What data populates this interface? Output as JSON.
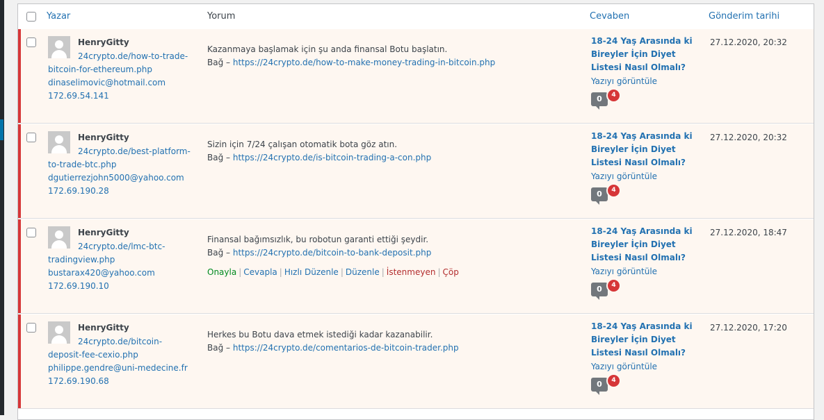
{
  "header": {
    "author": "Yazar",
    "comment": "Yorum",
    "response": "Cevaben",
    "date": "Gönderim tarihi"
  },
  "comments": [
    {
      "name": "HenryGitty",
      "url": "24crypto.de/how-to-trade-bitcoin-for-ethereum.php",
      "email": "dinaselimovic@hotmail.com",
      "ip": "172.69.54.141",
      "text": "Kazanmaya başlamak için şu anda finansal Botu başlatın.",
      "link_prefix": "Bağ –",
      "link": "https://24crypto.de/how-to-make-money-trading-in-bitcoin.php",
      "response_title": "18-24 Yaş Arasında ki Bireyler İçin Diyet Listesi Nasıl Olmalı?",
      "view_post": "Yazıyı görüntüle",
      "approved_count": "0",
      "pending_count": "4",
      "date": "27.12.2020, 20:32"
    },
    {
      "name": "HenryGitty",
      "url": "24crypto.de/best-platform-to-trade-btc.php",
      "email": "dgutierrezjohn5000@yahoo.com",
      "ip": "172.69.190.28",
      "text": "Sizin için 7/24 çalışan otomatik bota göz atın.",
      "link_prefix": "Bağ –",
      "link": "https://24crypto.de/is-bitcoin-trading-a-con.php",
      "response_title": "18-24 Yaş Arasında ki Bireyler İçin Diyet Listesi Nasıl Olmalı?",
      "view_post": "Yazıyı görüntüle",
      "approved_count": "0",
      "pending_count": "4",
      "date": "27.12.2020, 20:32"
    },
    {
      "name": "HenryGitty",
      "url": "24crypto.de/lmc-btc-tradingview.php",
      "email": "bustarax420@yahoo.com",
      "ip": "172.69.190.10",
      "text": "Finansal bağımsızlık, bu robotun garanti ettiği şeydir.",
      "link_prefix": "Bağ –",
      "link": "https://24crypto.de/bitcoin-to-bank-deposit.php",
      "response_title": "18-24 Yaş Arasında ki Bireyler İçin Diyet Listesi Nasıl Olmalı?",
      "view_post": "Yazıyı görüntüle",
      "approved_count": "0",
      "pending_count": "4",
      "date": "27.12.2020, 18:47",
      "actions": {
        "approve": "Onayla",
        "reply": "Cevapla",
        "quick_edit": "Hızlı Düzenle",
        "edit": "Düzenle",
        "spam": "İstenmeyen",
        "trash": "Çöp"
      }
    },
    {
      "name": "HenryGitty",
      "url": "24crypto.de/bitcoin-deposit-fee-cexio.php",
      "email": "philippe.gendre@uni-medecine.fr",
      "ip": "172.69.190.68",
      "text": "Herkes bu Botu dava etmek istediği kadar kazanabilir.",
      "link_prefix": "Bağ –",
      "link": "https://24crypto.de/comentarios-de-bitcoin-trader.php",
      "response_title": "18-24 Yaş Arasında ki Bireyler İçin Diyet Listesi Nasıl Olmalı?",
      "view_post": "Yazıyı görüntüle",
      "approved_count": "0",
      "pending_count": "4",
      "date": "27.12.2020, 17:20"
    }
  ]
}
